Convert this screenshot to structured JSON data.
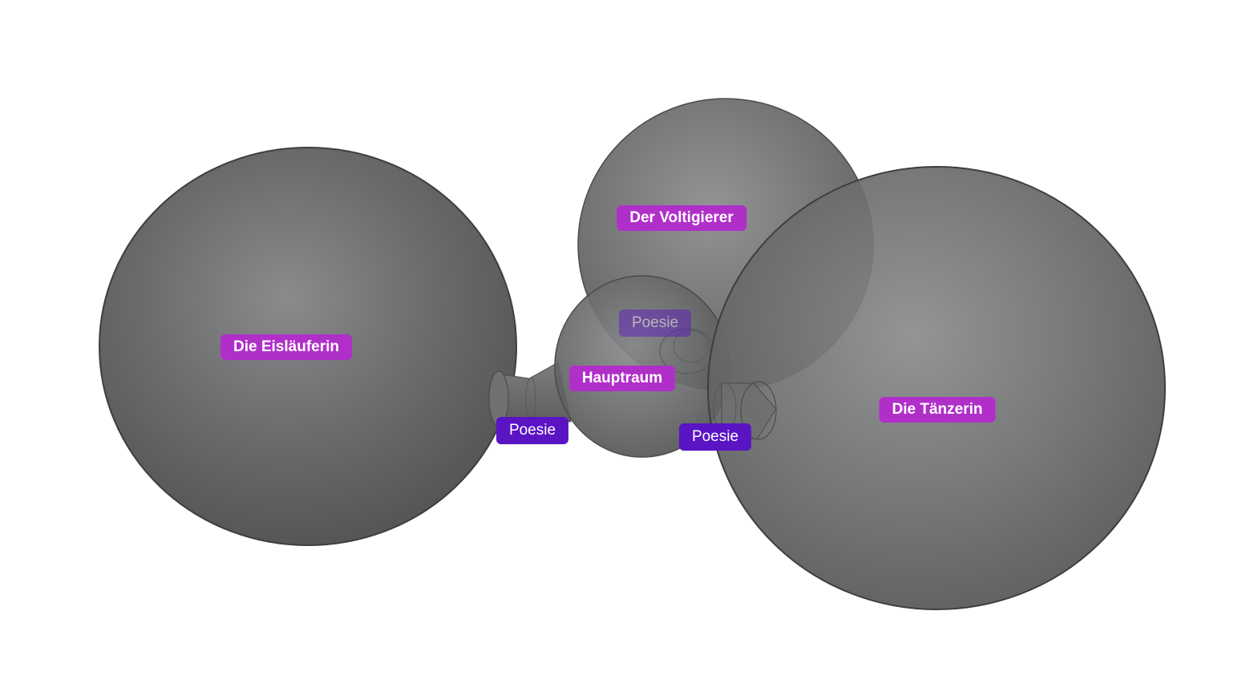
{
  "rooms": [
    {
      "id": "eislaeuferin",
      "label": "Die Eisläuferin"
    },
    {
      "id": "voltigierer",
      "label": "Der Voltigierer"
    },
    {
      "id": "hauptraum",
      "label": "Hauptraum"
    },
    {
      "id": "taenzerin",
      "label": "Die Tänzerin"
    }
  ],
  "portals": [
    {
      "id": "poesie-1",
      "label": "Poesie",
      "connects": [
        "Hauptraum",
        "Die Eisläuferin"
      ]
    },
    {
      "id": "poesie-2",
      "label": "Poesie",
      "connects": [
        "Hauptraum",
        "Die Tänzerin"
      ]
    },
    {
      "id": "poesie-3",
      "label": "Poesie",
      "connects": [
        "Hauptraum",
        "Der Voltigierer"
      ],
      "occluded": true
    }
  ],
  "colors": {
    "background": "#ffffff",
    "sphere_fill": "#6b6c6d",
    "sphere_highlight": "#8a8b8c",
    "sphere_edge": "#3d3e3f",
    "room_label_bg": "#b02fc9",
    "portal_label_bg": "#5a14c4",
    "label_text": "#ffffff"
  }
}
